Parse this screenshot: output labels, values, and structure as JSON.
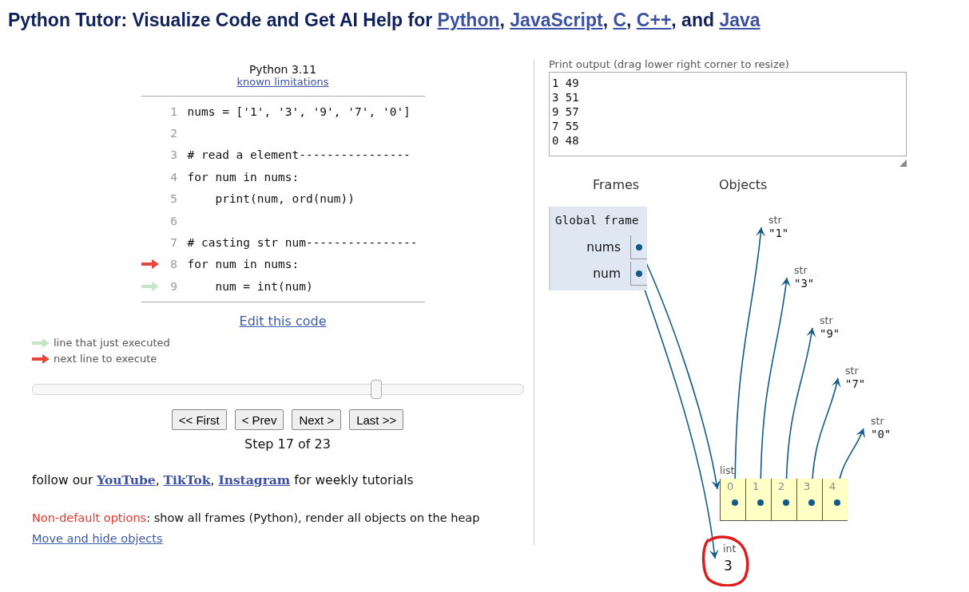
{
  "page_title": [
    {
      "kind": "text",
      "text": "Python Tutor: Visualize Code and Get AI Help for "
    },
    {
      "kind": "link",
      "text": "Python"
    },
    {
      "kind": "text",
      "text": ", "
    },
    {
      "kind": "link",
      "text": "JavaScript"
    },
    {
      "kind": "text",
      "text": ", "
    },
    {
      "kind": "link",
      "text": "C"
    },
    {
      "kind": "text",
      "text": ", "
    },
    {
      "kind": "link",
      "text": "C++"
    },
    {
      "kind": "text",
      "text": ", and "
    },
    {
      "kind": "link",
      "text": "Java"
    }
  ],
  "editor": {
    "language": "Python 3.11",
    "limitations_link": "known limitations",
    "lines": [
      {
        "number": "1",
        "code": "nums = ['1', '3', '9', '7', '0']",
        "just_executed": false,
        "next_to_execute": false
      },
      {
        "number": "2",
        "just_executed": false,
        "next_to_execute": false
      },
      {
        "number": "3",
        "code": "# read a element----------------",
        "just_executed": false,
        "next_to_execute": false
      },
      {
        "number": "4",
        "code": "for num in nums:",
        "just_executed": false,
        "next_to_execute": false
      },
      {
        "number": "5",
        "code": "    print(num, ord(num))",
        "just_executed": false,
        "next_to_execute": false
      },
      {
        "number": "6",
        "just_executed": false,
        "next_to_execute": false
      },
      {
        "number": "7",
        "code": "# casting str num----------------",
        "just_executed": false,
        "next_to_execute": false
      },
      {
        "number": "8",
        "code": "for num in nums:",
        "just_executed": false,
        "next_to_execute": true
      },
      {
        "number": "9",
        "code": "    num = int(num)",
        "just_executed": true,
        "next_to_execute": false
      }
    ],
    "edit_link": "Edit this code"
  },
  "legend": [
    {
      "kind": "executed",
      "text": "line that just executed"
    },
    {
      "kind": "next",
      "text": "next line to execute"
    }
  ],
  "slider": {
    "level": 0.7
  },
  "buttons": [
    "<< First",
    "< Prev",
    "Next >",
    "Last >>"
  ],
  "step_text": "Step 17 of 23",
  "follow": [
    {
      "kind": "text",
      "text": "follow our "
    },
    {
      "kind": "link",
      "text": "YouTube"
    },
    {
      "kind": "text",
      "text": ", "
    },
    {
      "kind": "link",
      "text": "TikTok"
    },
    {
      "kind": "text",
      "text": ", "
    },
    {
      "kind": "link",
      "text": "Instagram"
    },
    {
      "kind": "text",
      "text": " for weekly tutorials"
    }
  ],
  "options": {
    "label": "Non-default options",
    "text": ": show all frames (Python), render all objects on the heap"
  },
  "move_link": "Move and hide objects",
  "print_output": {
    "label": "Print output (drag lower right corner to resize)",
    "lines": [
      "1 49",
      "3 51",
      "9 57",
      "7 55",
      "0 48"
    ]
  },
  "visualization": {
    "frames_header": "Frames",
    "objects_header": "Objects",
    "frames": [
      {
        "name": "Global frame",
        "variables": [
          "nums",
          "num"
        ]
      }
    ],
    "strings": [
      {
        "type_label": "str",
        "value": "\"1\""
      },
      {
        "type_label": "str",
        "value": "\"3\""
      },
      {
        "type_label": "str",
        "value": "\"9\""
      },
      {
        "type_label": "str",
        "value": "\"7\""
      },
      {
        "type_label": "str",
        "value": "\"0\""
      }
    ],
    "list": {
      "type_label": "list",
      "indices": [
        "0",
        "1",
        "2",
        "3",
        "4"
      ]
    },
    "int": {
      "type_label": "int",
      "value": "3"
    }
  }
}
